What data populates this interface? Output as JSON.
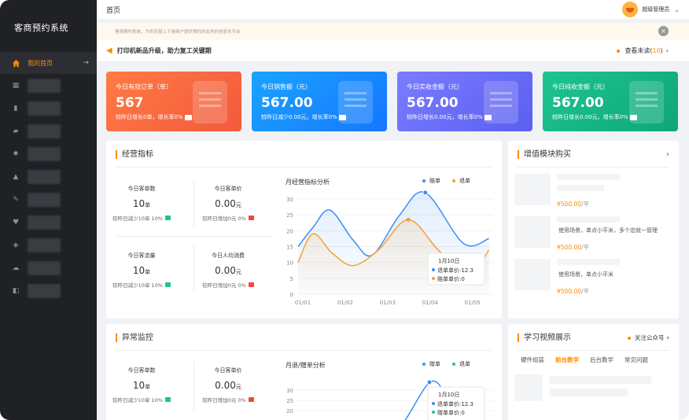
{
  "app": {
    "title": "客商预约系统"
  },
  "sidebar": {
    "active_label": "我的首页"
  },
  "topbar": {
    "page_title": "首页",
    "user_name": "超级管理员"
  },
  "notice": {
    "text": "客商预约系统，为供应链上下游商户提供预约的业务的信息化平台"
  },
  "announce": {
    "message": "打印机新品升级，助力复工关键期",
    "unread_prefix": "查看未读(",
    "unread_count": "10",
    "unread_suffix": ")"
  },
  "cards": [
    {
      "title": "今日有效订单（单）",
      "value": "567",
      "sub": "较昨日增长0单，增长率0%",
      "color_from": "#ff7a45",
      "color_to": "#f25a3c"
    },
    {
      "title": "今日销售额（元）",
      "value": "567.00",
      "sub": "较昨日减少0.00元，增长率0%",
      "color_from": "#1aa3ff",
      "color_to": "#1677ff"
    },
    {
      "title": "今日实收金额（元）",
      "value": "567.00",
      "sub": "较昨日增长0.00元，增长率0%",
      "color_from": "#7a7cff",
      "color_to": "#5b5ff0"
    },
    {
      "title": "今日纯收金额（元）",
      "value": "567.00",
      "sub": "较昨日增长0.00元，增长率0%",
      "color_from": "#1ec490",
      "color_to": "#0ea678"
    }
  ],
  "ops": {
    "title": "经营指标",
    "metrics": [
      {
        "label": "今日客单数",
        "value": "10",
        "unit": "单",
        "compare": "较昨日减少10单 10%",
        "tag_color": "#1ec490"
      },
      {
        "label": "今日客单价",
        "value": "0.00",
        "unit": "元",
        "compare": "较昨日增加0元 0%",
        "tag_color": "#f5453d"
      },
      {
        "label": "今日客流量",
        "value": "10",
        "unit": "单",
        "compare": "较昨日减少10单 10%",
        "tag_color": "#1ec490"
      },
      {
        "label": "今日人均消费",
        "value": "0.00",
        "unit": "元",
        "compare": "较昨日增加0元 0%",
        "tag_color": "#f5453d"
      }
    ]
  },
  "chart_data": [
    {
      "type": "line",
      "title": "月经营指标分析",
      "x": [
        "01/01",
        "01/02",
        "01/03",
        "01/04",
        "01/05"
      ],
      "ylim": [
        0,
        30
      ],
      "yticks": [
        0,
        5,
        10,
        15,
        20,
        25,
        30
      ],
      "series": [
        {
          "name": "赔单",
          "color": "#3b8ff7",
          "values": [
            15,
            21,
            26.5,
            17,
            12.3,
            25,
            32,
            16,
            17.5
          ],
          "x_pos": [
            0,
            0.35,
            0.75,
            1.3,
            1.75,
            2.4,
            3.0,
            3.9,
            4.5
          ]
        },
        {
          "name": "退单",
          "color": "#f7a032",
          "values": [
            10,
            19,
            13,
            9,
            14,
            23.5,
            14,
            5.5,
            14
          ],
          "x_pos": [
            0,
            0.35,
            0.8,
            1.3,
            1.9,
            2.6,
            3.3,
            4.0,
            4.5
          ]
        }
      ],
      "tooltip": {
        "title": "1月10日",
        "rows": [
          "退单单价:12.3",
          "赔单单价:0"
        ]
      }
    },
    {
      "type": "line",
      "title": "月退/赠单分析",
      "ylim": [
        0,
        30
      ],
      "yticks": [
        20,
        25,
        30
      ],
      "series": [
        {
          "name": "赠单",
          "color": "#3b8ff7"
        },
        {
          "name": "退单",
          "color": "#1ec490"
        }
      ],
      "tooltip": {
        "title": "1月10日",
        "rows": [
          "退单单价:12.3",
          "赠单单价:0"
        ]
      }
    }
  ],
  "value_modules": {
    "title": "增值模块购买",
    "items": [
      {
        "price": "¥500.00",
        "unit": "/平",
        "desc": ""
      },
      {
        "price": "¥500.00",
        "unit": "/平",
        "desc": "使用场景，单点小平米，多个店就一管理"
      },
      {
        "price": "¥500.00",
        "unit": "/平",
        "desc": "使用场景，单点小平米"
      }
    ]
  },
  "monitor": {
    "title": "异常监控",
    "metrics": [
      {
        "label": "今日客单数",
        "value": "10",
        "unit": "单",
        "compare": "较昨日减少10单 10%",
        "tag_color": "#1ec490"
      },
      {
        "label": "今日客单价",
        "value": "0.00",
        "unit": "元",
        "compare": "较昨日增加0元 0%",
        "tag_color": "#f5453d"
      }
    ]
  },
  "videos": {
    "title": "学习视频展示",
    "follow": "关注公众号",
    "tabs": [
      "硬件组装",
      "前台教学",
      "后台教学",
      "常见问题"
    ],
    "active_tab": 1
  }
}
